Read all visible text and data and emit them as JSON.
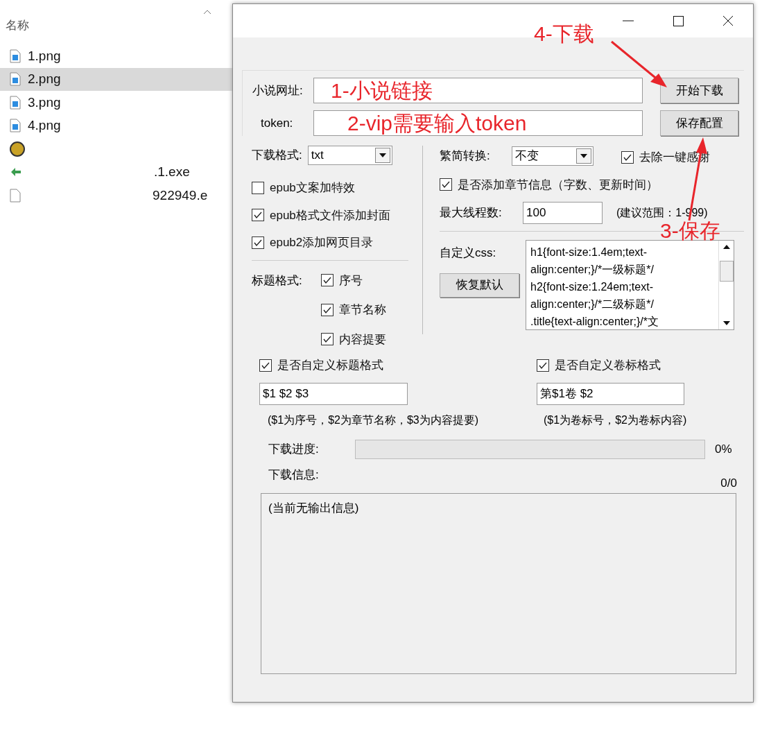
{
  "explorer": {
    "column_header": "名称",
    "files": [
      {
        "name": "1.png",
        "kind": "image",
        "selected": false
      },
      {
        "name": "2.png",
        "kind": "image",
        "selected": true
      },
      {
        "name": "3.png",
        "kind": "image",
        "selected": false
      },
      {
        "name": "4.png",
        "kind": "image",
        "selected": false
      },
      {
        "kind": "app",
        "selected": false
      },
      {
        "name": ".1.exe",
        "kind": "exe",
        "selected": false
      },
      {
        "name": "922949.e",
        "kind": "file",
        "selected": false
      }
    ]
  },
  "url": {
    "label": "小说网址:",
    "annotation": "1-小说链接"
  },
  "token": {
    "label": "token:",
    "annotation": "2-vip需要输入token"
  },
  "buttons": {
    "start": "开始下载",
    "save": "保存配置",
    "restore": "恢复默认"
  },
  "format": {
    "label": "下载格式:",
    "value": "txt"
  },
  "options": [
    {
      "label": "epub文案加特效",
      "checked": false
    },
    {
      "label": "epub格式文件添加封面",
      "checked": true
    },
    {
      "label": "epub2添加网页目录",
      "checked": true
    }
  ],
  "title_format": {
    "label": "标题格式:",
    "items": [
      {
        "label": "序号",
        "checked": true
      },
      {
        "label": "章节名称",
        "checked": true
      },
      {
        "label": "内容提要",
        "checked": true
      }
    ]
  },
  "conversion": {
    "label": "繁简转换:",
    "value": "不变"
  },
  "remove_thanks": {
    "label": "去除一键感谢",
    "checked": true
  },
  "chapter_info": {
    "label": "是否添加章节信息（字数、更新时间）",
    "checked": true
  },
  "threads": {
    "label": "最大线程数:",
    "value": "100",
    "hint": "(建议范围：1-999)"
  },
  "css": {
    "label": "自定义css:",
    "lines": [
      "h1{font-size:1.4em;text-",
      "align:center;}/*一级标题*/",
      "h2{font-size:1.24em;text-",
      "align:center;}/*二级标题*/",
      ".title{text-align:center;}/*文"
    ]
  },
  "custom_title": {
    "label": "是否自定义标题格式",
    "checked": true,
    "value": "$1 $2 $3",
    "hint": "($1为序号，$2为章节名称，$3为内容提要)"
  },
  "custom_volume": {
    "label": "是否自定义卷标格式",
    "checked": true,
    "value": "第$1卷 $2",
    "hint": "($1为卷标号，$2为卷标内容)"
  },
  "progress": {
    "label": "下载进度:",
    "level": 0,
    "percent": "0%"
  },
  "info": {
    "label": "下载信息:",
    "count": "0/0",
    "output": "(当前无输出信息)"
  },
  "annotations": [
    {
      "text": "4-下载"
    },
    {
      "text": "3-保存"
    }
  ]
}
